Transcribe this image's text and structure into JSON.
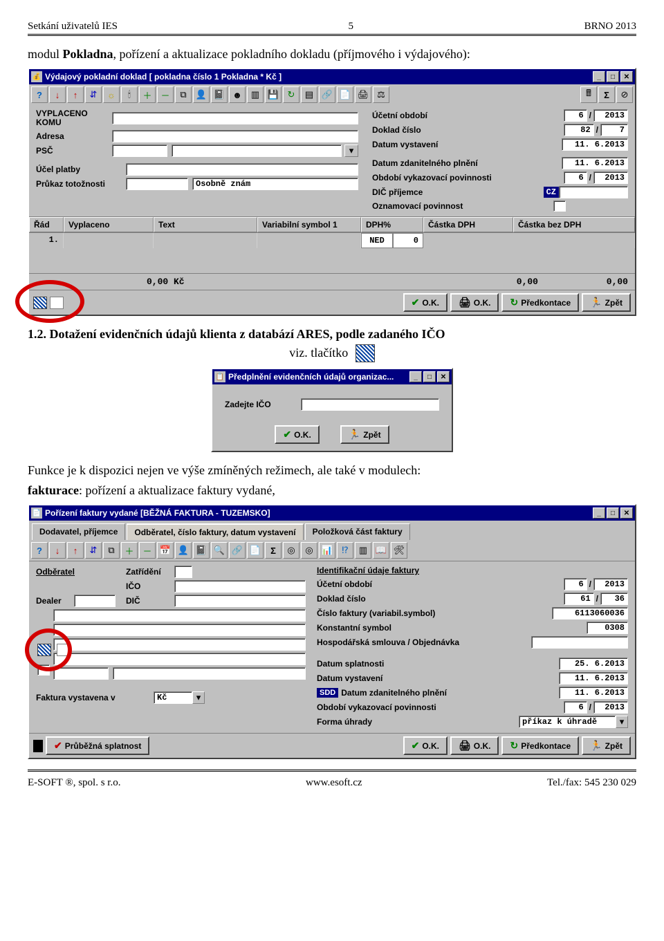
{
  "header": {
    "left": "Setkání uživatelů IES",
    "center": "5",
    "right": "BRNO 2013"
  },
  "para1_prefix": "modul ",
  "para1_bold": "Pokladna",
  "para1_rest": ", pořízení a aktualizace pokladního dokladu (příjmového i výdajového):",
  "win1": {
    "title": "Výdajový pokladní doklad    [ pokladna číslo 1 Pokladna * Kč ]",
    "labels": {
      "vyplaceno_komu": "VYPLACENO KOMU",
      "adresa": "Adresa",
      "psc": "PSČ",
      "ucel": "Účel platby",
      "prukaz": "Průkaz totožnosti",
      "prukaz_val": "Osobně znám",
      "ucetni_obdobi": "Účetní období",
      "uo_val_m": "6",
      "uo_sep": "/",
      "uo_val_y": "2013",
      "doklad_cislo": "Doklad číslo",
      "dc_val1": "82",
      "dc_sep": "/",
      "dc_val2": "7",
      "datum_vyst": "Datum vystavení",
      "datum_vyst_val": "11. 6.2013",
      "datum_zdan": "Datum zdanitelného plnění",
      "datum_zdan_val": "11. 6.2013",
      "obdobi_vyk": "Období vykazovací povinnosti",
      "ov_m": "6",
      "ov_sep": "/",
      "ov_y": "2013",
      "dic": "DIČ příjemce",
      "dic_prefix": "CZ",
      "oznam": "Oznamovací povinnost"
    },
    "grid": {
      "h_rad": "Řád",
      "h_vyp": "Vyplaceno",
      "h_text": "Text",
      "h_vs": "Variabilní symbol 1",
      "h_dph": "DPH%",
      "h_cdph": "Částka DPH",
      "h_bez": "Částka bez DPH",
      "r_rad": "1.",
      "r_ned": "NED",
      "r_zero": "0"
    },
    "totals": {
      "left": "0,00  Kč",
      "mid": "0,00",
      "right": "0,00"
    },
    "buttons": {
      "ok": "O.K.",
      "okp": "O.K.",
      "pred": "Předkontace",
      "zpet": "Zpět"
    }
  },
  "section12_num": "1.2. ",
  "section12_bold": "Dotažení evidenčních údajů klienta z databází ARES, podle zadaného IČO",
  "viz_tlacitko": "viz. tlačítko",
  "dlg": {
    "title": "Předplnění evidenčních údajů organizac...",
    "label": "Zadejte IČO",
    "ok": "O.K.",
    "zpet": "Zpět"
  },
  "para2_a": "Funkce je k dispozici nejen ve výše zmíněných režimech, ale také v modulech:",
  "para2_b_bold": "fakturace",
  "para2_b_rest": ": pořízení a aktualizace faktury vydané,",
  "win2": {
    "title": "Pořízení faktury vydané [BĚŽNÁ FAKTURA - TUZEMSKO]",
    "tabs": {
      "t1": "Dodavatel, příjemce",
      "t2": "Odběratel, číslo faktury, datum vystavení",
      "t3": "Položková část faktury"
    },
    "left": {
      "odberatel": "Odběratel",
      "zatrideni": "Zatřídění",
      "ico": "IČO",
      "dic": "DIČ",
      "dealer": "Dealer",
      "faktura_v": "Faktura vystavena v",
      "kc": "Kč"
    },
    "right": {
      "ident": "Identifikační údaje faktury",
      "ucetni": "Účetní období",
      "uo_m": "6",
      "uo_sep": "/",
      "uo_y": "2013",
      "doklad": "Doklad číslo",
      "dc1": "61",
      "dc_sep": "/",
      "dc2": "36",
      "cislo_f": "Číslo faktury (variabil.symbol)",
      "cf_val": "6113060036",
      "ks": "Konstantní symbol",
      "ks_val": "0308",
      "hs": "Hospodářská smlouva / Objednávka",
      "splat": "Datum splatnosti",
      "splat_val": "25. 6.2013",
      "vyst": "Datum vystavení",
      "vyst_val": "11. 6.2013",
      "sdd": "SDD",
      "zdan": "Datum zdanitelného plnění",
      "zdan_val": "11. 6.2013",
      "ov": "Období vykazovací povinnosti",
      "ov_m": "6",
      "ov_sep": "/",
      "ov_y": "2013",
      "forma": "Forma úhrady",
      "forma_val": "příkaz k úhradě"
    },
    "bottom": {
      "prub": "Průběžná splatnost",
      "ok": "O.K.",
      "okp": "O.K.",
      "pred": "Předkontace",
      "zpet": "Zpět"
    }
  },
  "footer": {
    "left": "E-SOFT ®, spol. s r.o.",
    "center": "www.esoft.cz",
    "right": "Tel./fax: 545 230 029"
  }
}
